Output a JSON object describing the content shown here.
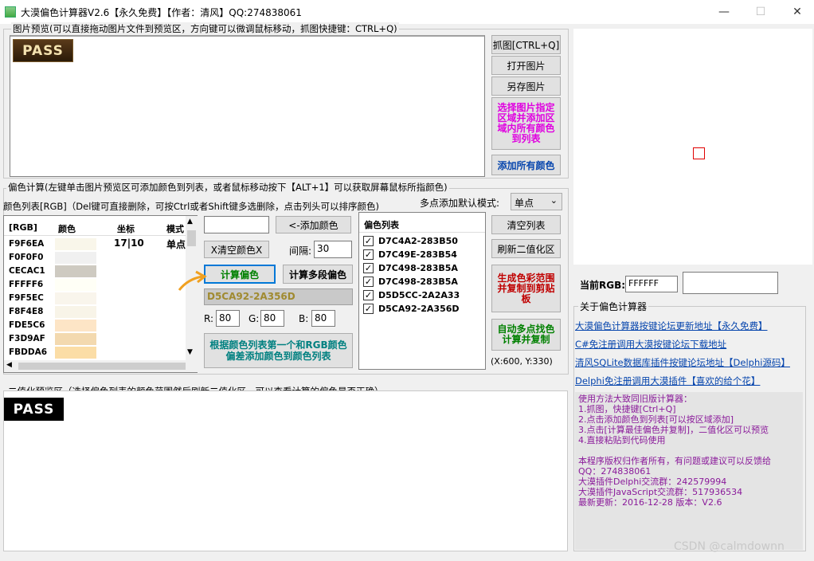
{
  "window": {
    "title": "大漠偏色计算器V2.6【永久免费】【作者：清风】QQ:274838061",
    "minimize": "—",
    "maximize": "☐",
    "close": "✕"
  },
  "preview": {
    "label": "图片预览(可以直接拖动图片文件到预览区，方向键可以微调鼠标移动，抓图快捷键：CTRL+Q)",
    "image_text": "PASS"
  },
  "side_buttons": {
    "capture": "抓图[CTRL+Q]",
    "open": "打开图片",
    "save_as": "另存图片",
    "select_region": "选择图片指定区域并添加区域内所有颜色到列表",
    "add_all": "添加所有颜色"
  },
  "calc": {
    "label": "偏色计算(左键单击图片预览区可添加颜色到列表，或者鼠标移动按下【ALT+1】可以获取屏幕鼠标所指颜色)",
    "color_list_label": "颜色列表[RGB]（Del键可直接删除，可按Ctrl或者Shift键多选删除，点击列头可以排序颜色)",
    "multi_mode_label": "多点添加默认模式:",
    "multi_mode_value": "单点",
    "table_headers": [
      "[RGB]",
      "颜色",
      "坐标",
      "模式"
    ],
    "coord_value": "17|10",
    "mode_value": "单点",
    "rows": [
      {
        "rgb": "F9F6EA",
        "color": "#F9F6EA"
      },
      {
        "rgb": "F0F0F0",
        "color": "#F0F0F0"
      },
      {
        "rgb": "CECAC1",
        "color": "#CECAC1"
      },
      {
        "rgb": "FFFFF6",
        "color": "#FFFFF6"
      },
      {
        "rgb": "F9F5EC",
        "color": "#F9F5EC"
      },
      {
        "rgb": "F8F4E8",
        "color": "#F8F4E8"
      },
      {
        "rgb": "FDE5C6",
        "color": "#FDE5C6"
      },
      {
        "rgb": "F3D9AF",
        "color": "#F3D9AF"
      },
      {
        "rgb": "FBDDA6",
        "color": "#FBDDA6"
      }
    ],
    "add_color_btn": "<-添加颜色",
    "clear_color_btn": "X清空颜色X",
    "interval_label": "间隔:",
    "interval_value": "30",
    "calc_btn": "计算偏色",
    "calc_multi_btn": "计算多段偏色",
    "result": "D5CA92-2A356D",
    "r_label": "R:",
    "r_value": "80",
    "g_label": "G:",
    "g_value": "80",
    "b_label": "B:",
    "b_value": "80",
    "add_by_first_btn": "根据颜色列表第一个和RGB颜色偏差添加颜色到颜色列表",
    "offset_header": "偏色列表",
    "offsets": [
      "D7C4A2-283B50",
      "D7C49E-283B54",
      "D7C498-283B5A",
      "D7C498-283B5A",
      "D5D5CC-2A2A33",
      "D5CA92-2A356D"
    ],
    "clear_list_btn": "清空列表",
    "refresh_bin_btn": "刷新二值化区",
    "gen_range_btn": "生成色彩范围并复制到剪贴板",
    "auto_multi_btn": "自动多点找色计算并复制",
    "coords_readout": "(X:600, Y:330)"
  },
  "binary": {
    "label": "二值化预览区（选择偏色列表的颜色范围然后刷新二值化区，可以查看计算的偏色是否正确）",
    "image_text": "PASS"
  },
  "right": {
    "current_rgb_label": "当前RGB:",
    "current_rgb_value": "FFFFFF",
    "about_label": "关于偏色计算器",
    "links": [
      "大漠偏色计算器按键论坛更新地址【永久免费】",
      "C#免注册调用大漠按键论坛下载地址",
      "清风SQLite数据库插件按键论坛地址【Delphi源码】",
      "Delphi免注册调用大漠插件【喜欢的给个花】"
    ],
    "usage": [
      "使用方法大致同旧版计算器：",
      "1.抓图，快捷键[Ctrl+Q]",
      "2.点击添加颜色到列表[可以按区域添加]",
      "3.点击[计算最佳偏色并复制]，二值化区可以预览",
      "4.直接粘贴到代码使用",
      "",
      "本程序版权归作者所有，有问题或建议可以反馈给",
      "QQ：274838061",
      "大漠插件Delphi交流群：242579994",
      "大漠插件JavaScript交流群：517936534",
      "最新更新：2016-12-28 版本：V2.6"
    ]
  },
  "watermark": "CSDN @calmdownn",
  "colors": {
    "accent_magenta": "#e000e0",
    "accent_red": "#c00000",
    "accent_green": "#008000",
    "accent_blue": "#0645ad",
    "result_bg": "#c9c9c9",
    "result_fg": "#a08a30",
    "arrow": "#f0a020"
  }
}
